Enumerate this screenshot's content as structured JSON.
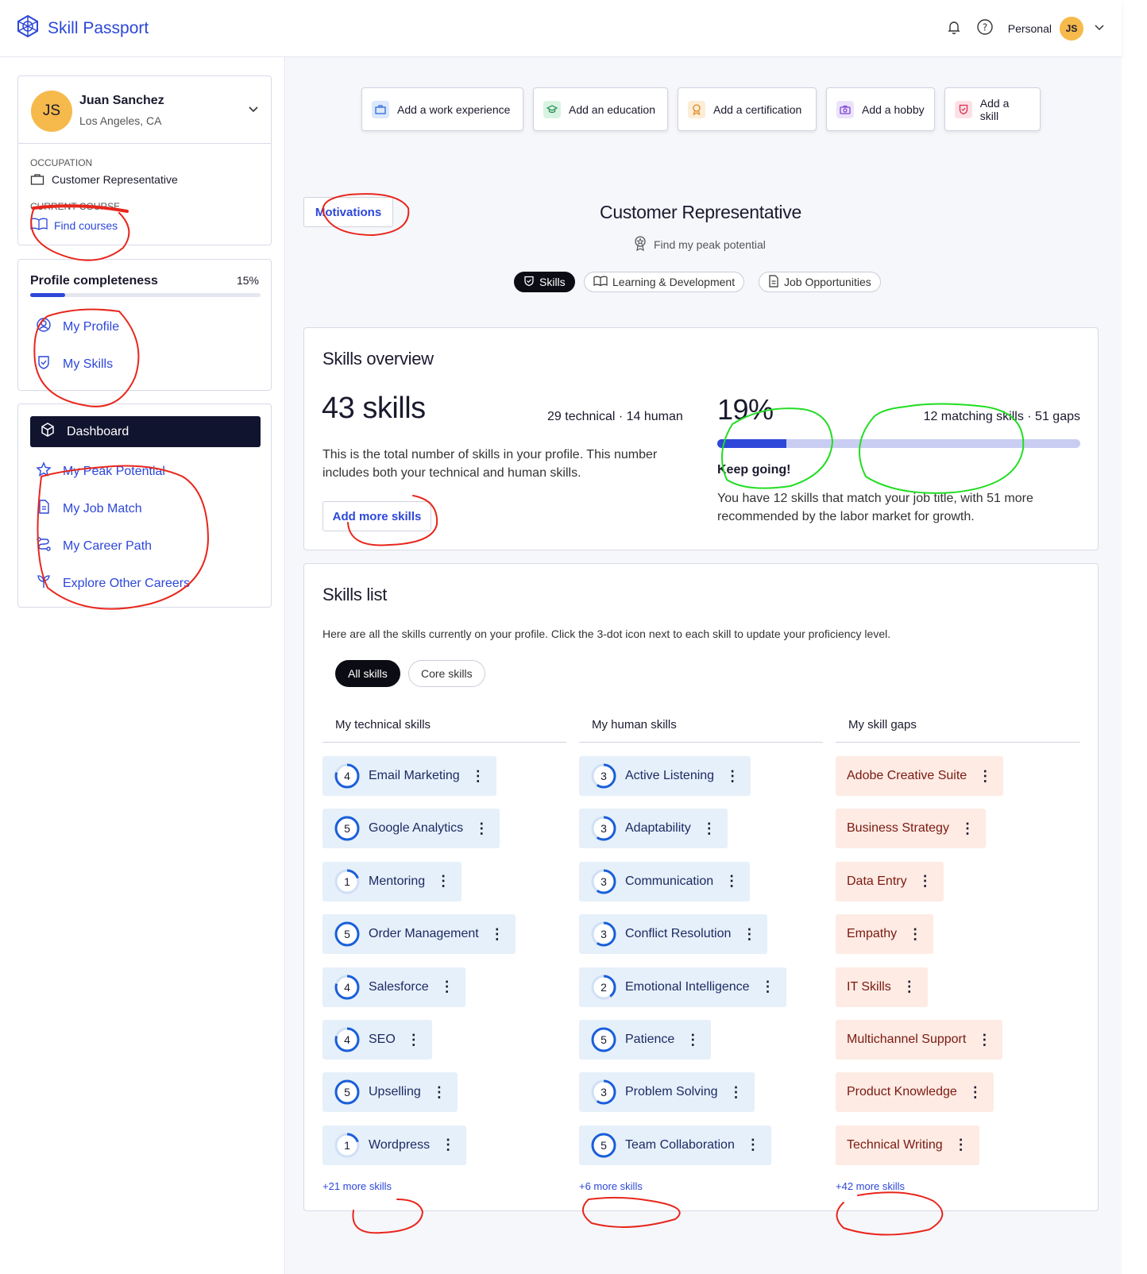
{
  "header": {
    "app_title": "Skill Passport",
    "account_label": "Personal",
    "avatar_initials": "JS"
  },
  "profile": {
    "initials": "JS",
    "name": "Juan Sanchez",
    "location": "Los Angeles, CA",
    "occupation_label": "OCCUPATION",
    "occupation": "Customer Representative",
    "courses_label": "CURRENT COURSE",
    "find_courses": "Find courses"
  },
  "completeness": {
    "label": "Profile completeness",
    "percent_text": "15%",
    "fraction": 0.15,
    "links": [
      "My Profile",
      "My Skills"
    ]
  },
  "nav": {
    "active": "Dashboard",
    "items": [
      "My Peak Potential",
      "My Job Match",
      "My Career Path",
      "Explore Other Careers"
    ]
  },
  "actions": [
    "Add a work experience",
    "Add an education",
    "Add a certification",
    "Add a hobby",
    "Add a skill"
  ],
  "job": {
    "motivations": "Motivations",
    "title": "Customer Representative",
    "peak_link": "Find my peak potential",
    "tabs": [
      "Skills",
      "Learning & Development",
      "Job Opportunities"
    ]
  },
  "overview": {
    "title": "Skills overview",
    "count": "43 skills",
    "breakdown": "29 technical · 14 human",
    "description": "This is the total number of skills in your profile. This number includes both your technical and human skills.",
    "add_button": "Add more skills",
    "percent": "19%",
    "fraction": 0.19,
    "match_summary": "12 matching skills · 51 gaps",
    "status": "Keep going!",
    "match_description": "You have 12 skills that match your job title, with 51 more recommended by the labor market for growth."
  },
  "skills_list": {
    "title": "Skills list",
    "description": "Here are all the skills currently on your profile. Click the 3-dot icon next to each skill to update your proficiency level.",
    "filters": [
      "All skills",
      "Core skills"
    ],
    "technical": {
      "heading": "My technical skills",
      "items": [
        {
          "name": "Email Marketing",
          "level": 4
        },
        {
          "name": "Google Analytics",
          "level": 5
        },
        {
          "name": "Mentoring",
          "level": 1
        },
        {
          "name": "Order Management",
          "level": 5
        },
        {
          "name": "Salesforce",
          "level": 4
        },
        {
          "name": "SEO",
          "level": 4
        },
        {
          "name": "Upselling",
          "level": 5
        },
        {
          "name": "Wordpress",
          "level": 1
        }
      ],
      "more": "+21 more skills"
    },
    "human": {
      "heading": "My human skills",
      "items": [
        {
          "name": "Active Listening",
          "level": 3
        },
        {
          "name": "Adaptability",
          "level": 3
        },
        {
          "name": "Communication",
          "level": 3
        },
        {
          "name": "Conflict Resolution",
          "level": 3
        },
        {
          "name": "Emotional Intelligence",
          "level": 2
        },
        {
          "name": "Patience",
          "level": 5
        },
        {
          "name": "Problem Solving",
          "level": 3
        },
        {
          "name": "Team Collaboration",
          "level": 5
        }
      ],
      "more": "+6 more skills"
    },
    "gaps": {
      "heading": "My skill gaps",
      "items": [
        "Adobe Creative Suite",
        "Business Strategy",
        "Data Entry",
        "Empathy",
        "IT Skills",
        "Multichannel Support",
        "Product Knowledge",
        "Technical Writing"
      ],
      "more": "+42 more skills"
    }
  },
  "colors": {
    "primary": "#2d47d9",
    "dark": "#10142e",
    "skill_blue": "#e6f0fa",
    "skill_red": "#fdebe4",
    "annotation_red": "#e8261c",
    "annotation_green": "#22dd22"
  }
}
